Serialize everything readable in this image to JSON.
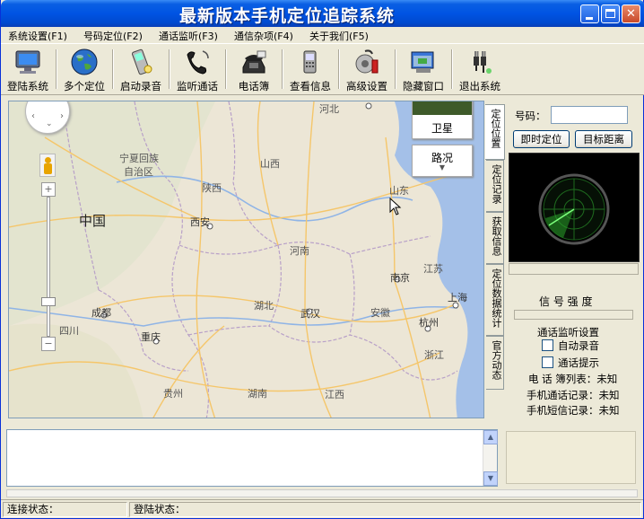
{
  "window": {
    "title": "最新版本手机定位追踪系统"
  },
  "menu": [
    {
      "label": "系统设置(F1)"
    },
    {
      "label": "号码定位(F2)"
    },
    {
      "label": "通话监听(F3)"
    },
    {
      "label": "通信杂项(F4)"
    },
    {
      "label": "关于我们(F5)"
    }
  ],
  "toolbar": [
    {
      "label": "登陆系统",
      "icon": "monitor-icon"
    },
    {
      "label": "多个定位",
      "icon": "globe-icon"
    },
    {
      "label": "启动录音",
      "icon": "mobile-phone-icon"
    },
    {
      "label": "监听通话",
      "icon": "telephone-handset-icon"
    },
    {
      "label": "电话簿",
      "icon": "desk-phone-icon"
    },
    {
      "label": "查看信息",
      "icon": "phone-message-icon"
    },
    {
      "label": "高级设置",
      "icon": "settings-icon"
    },
    {
      "label": "隐藏窗口",
      "icon": "window-icon"
    },
    {
      "label": "退出系统",
      "icon": "plug-icon"
    }
  ],
  "map": {
    "satellite_label": "卫星",
    "traffic_label": "路况",
    "labels": {
      "ningxia": "宁夏回族",
      "ningxia2": "自治区",
      "china": "中国",
      "shanxi_n": "山西",
      "shaanxi": "陕西",
      "hebei": "河北",
      "shandong": "山东",
      "xian": "西安",
      "henan": "河南",
      "nanjing": "南京",
      "jiangsu": "江苏",
      "shanghai": "上海",
      "hubei": "湖北",
      "chengdu": "成都",
      "wuhan": "武汉",
      "anhui": "安徽",
      "hangzhou": "杭州",
      "sichuan": "四川",
      "chongqing": "重庆",
      "zhejiang": "浙江",
      "guizhou": "贵州",
      "hunan": "湖南",
      "jiangxi": "江西"
    }
  },
  "side_tabs": [
    {
      "label": "定位位置"
    },
    {
      "label": "定位记录"
    },
    {
      "label": "获取信息"
    },
    {
      "label": "定位数据统计"
    },
    {
      "label": "官方动态"
    }
  ],
  "panel": {
    "number_label": "号码：",
    "number_value": "",
    "locate_button": "即时定位",
    "distance_button": "目标距离",
    "signal_label": "信 号 强 度",
    "monitor_settings": "通话监听设置",
    "auto_record": "自动录音",
    "call_alert": "通话提示",
    "phonebook": "电 话 簿列表：未知",
    "call_log": "手机通话记录：未知",
    "sms_log": "手机短信记录：未知"
  },
  "status": {
    "connection": "连接状态：",
    "login": "登陆状态："
  }
}
